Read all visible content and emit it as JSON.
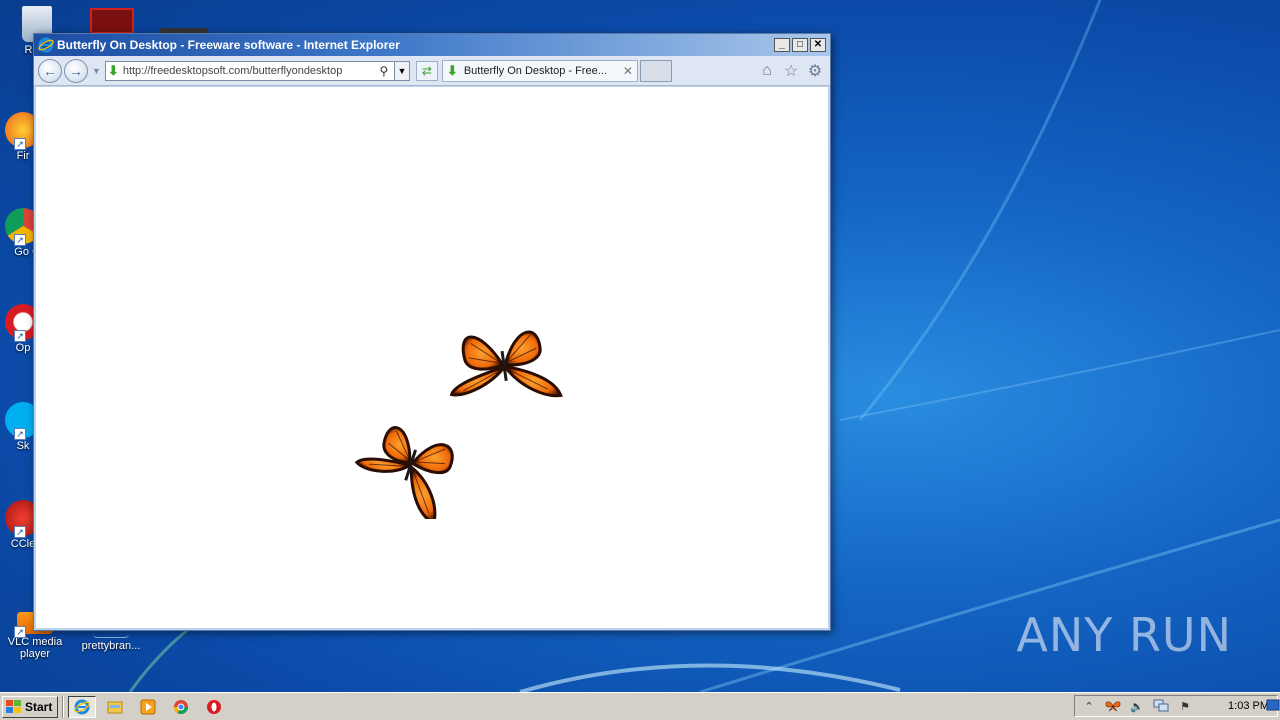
{
  "window": {
    "title": "Butterfly On Desktop - Freeware software - Internet Explorer",
    "minimize_label": "_",
    "maximize_label": "□",
    "close_label": "✕"
  },
  "toolbar": {
    "address_value": "http://freedesktopsoft.com/butterflyondesktop",
    "tab_title": "Butterfly On Desktop - Free...",
    "tab_close": "✕"
  },
  "content": {
    "butterfly_count": 2
  },
  "desktop": {
    "icons": [
      {
        "label": "Recy"
      },
      {
        "label": "Fir"
      },
      {
        "label": "Go Chr"
      },
      {
        "label": "Op"
      },
      {
        "label": "Sk"
      },
      {
        "label": "CCle"
      },
      {
        "label": "VLC media player"
      },
      {
        "label": "prettybran..."
      }
    ]
  },
  "watermark": "ANY RUN",
  "taskbar": {
    "start_label": "Start",
    "clock": "1:03 PM"
  },
  "colors": {
    "desktop_blue": "#1465c4",
    "titlebar_blue": "#1c4ea3",
    "taskbar_gray": "#d4d0c8",
    "butterfly_orange": "#f07a10"
  }
}
